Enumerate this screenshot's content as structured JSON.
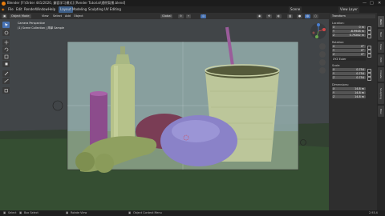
{
  "window": {
    "title": "Blender [F:\\Order 441/2020, 兼容学习模式] [Render Tutorial\\透明背景.blend]"
  },
  "menu": {
    "items": [
      "File",
      "Edit",
      "Render",
      "Window",
      "Help"
    ],
    "tabs": [
      "Layout",
      "Modeling",
      "Sculpting",
      "UV Editing"
    ]
  },
  "topright": {
    "scene": "Scene",
    "view_layer": "View Layer"
  },
  "header": {
    "mode": "Object Mode",
    "items": [
      "View",
      "Select",
      "Add",
      "Object"
    ],
    "orientation": "Global",
    "right_buttons": [
      "Options"
    ]
  },
  "viewport": {
    "perspective": "Camera Perspective",
    "collection": "(1) Scene Collection | 简单 Sample"
  },
  "npanel": {
    "section_title": "Transform",
    "location_label": "Location:",
    "location": [
      {
        "axis": "X",
        "value": "0 m"
      },
      {
        "axis": "Y",
        "value": "-6.9948 m"
      },
      {
        "axis": "Z",
        "value": "0.79262 m"
      }
    ],
    "rotation_label": "Rotation:",
    "rotation": [
      {
        "axis": "X",
        "value": "0°"
      },
      {
        "axis": "Y",
        "value": "0°"
      },
      {
        "axis": "Z",
        "value": "0°"
      }
    ],
    "rotation_mode": "XYZ Euler",
    "scale_label": "Scale:",
    "scale": [
      {
        "axis": "X",
        "value": "0.754"
      },
      {
        "axis": "Y",
        "value": "0.754"
      },
      {
        "axis": "Z",
        "value": "0.754"
      }
    ],
    "dimensions_label": "Dimensions:",
    "dimensions": [
      {
        "axis": "X",
        "value": "14.8 m"
      },
      {
        "axis": "Y",
        "value": "14.8 m"
      },
      {
        "axis": "Z",
        "value": "14.8 m"
      }
    ]
  },
  "sidetabs": [
    "Item",
    "Tool",
    "View",
    "Edit",
    "Create",
    "Sculpting",
    "Misc"
  ],
  "status": {
    "select": "Select",
    "box_select": "Box Select",
    "rotate_view": "Rotate View",
    "context_menu": "Object Context Menu",
    "version": "2.93.4"
  }
}
